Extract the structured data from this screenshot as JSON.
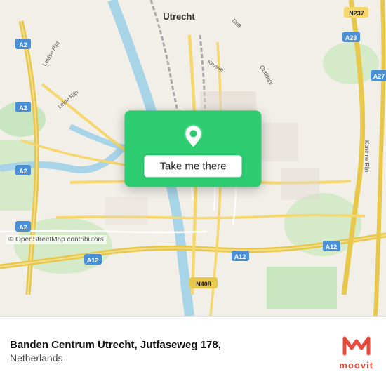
{
  "map": {
    "city": "Utrecht",
    "country": "Netherlands",
    "copyright": "© OpenStreetMap contributors"
  },
  "popup": {
    "button_label": "Take me there"
  },
  "info": {
    "title": "Banden Centrum Utrecht, Jutfaseweg 178,",
    "subtitle": "Netherlands"
  },
  "logo": {
    "icon": "M",
    "text": "moovit"
  }
}
